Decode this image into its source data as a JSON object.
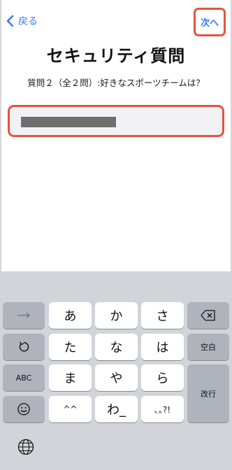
{
  "nav": {
    "back_label": "戻る",
    "next_label": "次へ"
  },
  "page": {
    "title": "セキュリティ質問",
    "question": "質問２（全２問）:好きなスポーツチームは？"
  },
  "answer_field": {
    "value_redacted": true
  },
  "keyboard": {
    "row1": [
      "あ",
      "か",
      "さ"
    ],
    "row2": [
      "た",
      "な",
      "は"
    ],
    "row3": [
      "ま",
      "や",
      "ら"
    ],
    "row4": [
      "^^",
      "わ_",
      "､｡?!"
    ],
    "abc_label": "ABC",
    "space_label": "空白",
    "return_label": "改行"
  },
  "colors": {
    "accent": "#3478f6",
    "highlight": "#e5533d"
  }
}
